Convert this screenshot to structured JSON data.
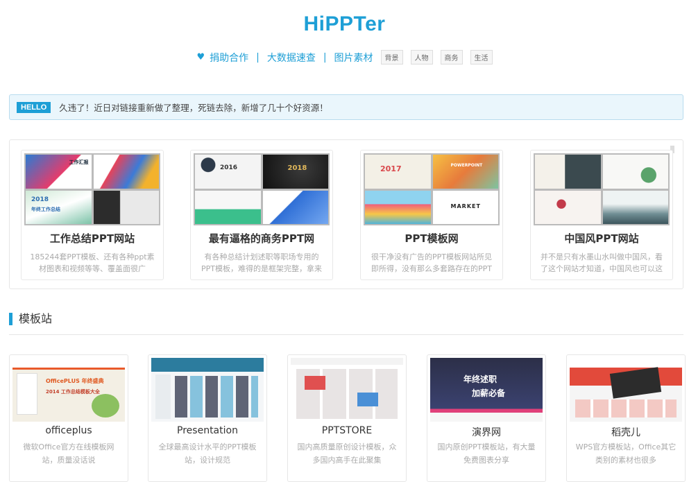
{
  "header": {
    "logo": "HiPPTer",
    "nav": {
      "heart_icon": "heart-icon",
      "donate": "捐助合作",
      "data_search": "大数据速查",
      "image_assets": "图片素材",
      "separator": "|",
      "tags": [
        "背景",
        "人物",
        "商务",
        "生活"
      ]
    }
  },
  "notice": {
    "badge": "HELLO",
    "text": "久违了！近日对链接重新做了整理，死链去除，新增了几十个好资源！"
  },
  "featured": [
    {
      "title": "工作总结PPT网站",
      "desc": "185244套PPT模板、还有各种ppt素材图表和视频等等、覆盖面很广",
      "thumb_text": [
        "工作汇报",
        "2018",
        "年终工作总结"
      ]
    },
    {
      "title": "最有逼格的商务PPT网",
      "desc": "有各种总结计划述职等职场专用的PPT模板，难得的是框架完整，拿来就能用",
      "thumb_text": [
        "2016",
        "2018"
      ]
    },
    {
      "title": "PPT模板网",
      "desc": "很干净没有广告的PPT模板网站所见即所得，没有那么多套路存在的PPT网站",
      "thumb_text": [
        "2017",
        "POWERPOINT",
        "MARKET"
      ]
    },
    {
      "title": "中国风PPT网站",
      "desc": "并不是只有水墨山水叫做中国风，看了这个网站才知道，中国风也可以这么潮",
      "thumb_text": []
    }
  ],
  "section": {
    "title": "模板站"
  },
  "templates": [
    {
      "name": "officeplus",
      "desc": "微软Office官方在线模板网站，质量没话说",
      "thumb_text": [
        "OfficePLUS 年终盛典",
        "2014 工作总结模板大全"
      ]
    },
    {
      "name": "Presentation",
      "desc": "全球最高设计水平的PPT模板站，设计规范",
      "thumb_text": []
    },
    {
      "name": "PPTSTORE",
      "desc": "国内高质量原创设计模板，众多国内高手在此聚集",
      "thumb_text": []
    },
    {
      "name": "演界网",
      "desc": "国内原创PPT模板站，有大量免费图表分享",
      "thumb_text": [
        "年终述职",
        "加薪必备"
      ]
    },
    {
      "name": "稻壳儿",
      "desc": "WPS官方模板站，Office其它类别的素材也很多",
      "thumb_text": []
    }
  ]
}
